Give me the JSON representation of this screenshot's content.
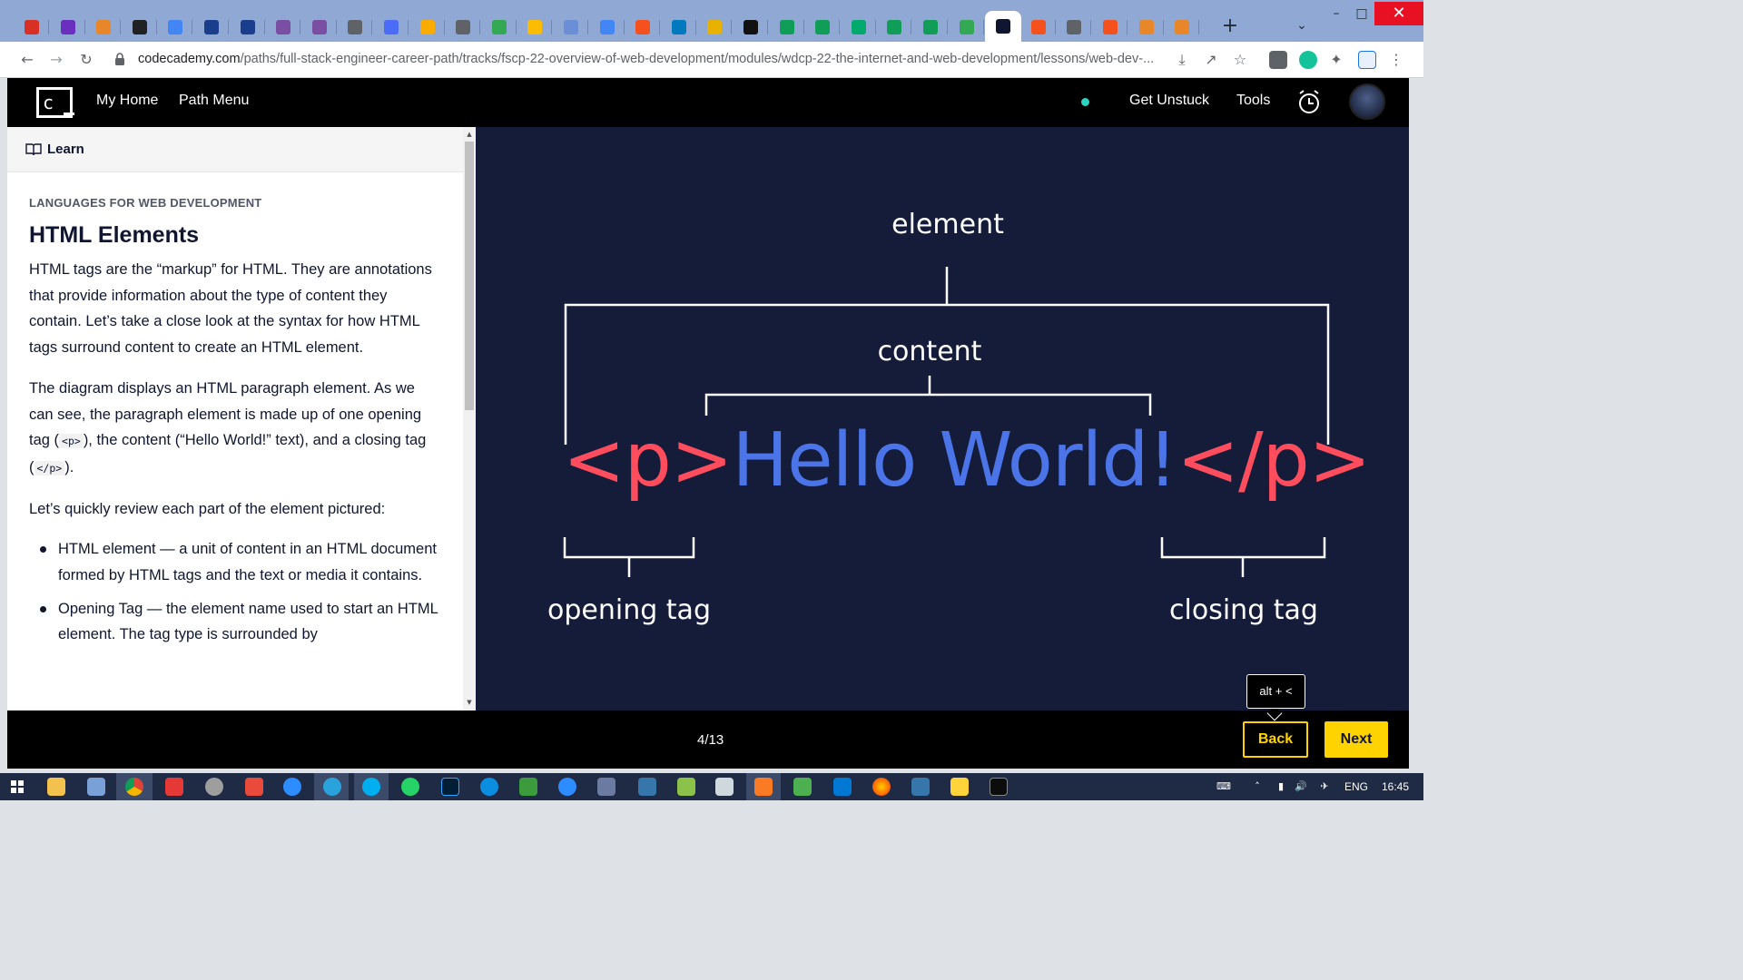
{
  "browser": {
    "tabs": [
      {
        "icon": "gmail-icon",
        "color": "#d93025"
      },
      {
        "icon": "mail-icon",
        "color": "#6b2fbf"
      },
      {
        "icon": "pma-icon",
        "color": "#e8862a"
      },
      {
        "icon": "clock-icon",
        "color": "#202124"
      },
      {
        "icon": "translate-icon",
        "color": "#4285f4"
      },
      {
        "icon": "n-icon",
        "color": "#1a3e8c"
      },
      {
        "icon": "n-icon",
        "color": "#1a3e8c"
      },
      {
        "icon": "triangle-icon",
        "color": "#7a4fa3"
      },
      {
        "icon": "triangle-icon",
        "color": "#7a4fa3"
      },
      {
        "icon": "globe-icon",
        "color": "#5f6368"
      },
      {
        "icon": "people-icon",
        "color": "#4a6cf7"
      },
      {
        "icon": "analytics-icon",
        "color": "#f9ab00"
      },
      {
        "icon": "printer-icon",
        "color": "#5f6368"
      },
      {
        "icon": "ads-icon",
        "color": "#34a853"
      },
      {
        "icon": "ads-icon",
        "color": "#fbbc04"
      },
      {
        "icon": "rpi-icon",
        "color": "#6b8fd6"
      },
      {
        "icon": "doc-icon",
        "color": "#4285f4"
      },
      {
        "icon": "slash-icon",
        "color": "#f4511e"
      },
      {
        "icon": "trello-icon",
        "color": "#0079bf"
      },
      {
        "icon": "chrome-icon",
        "color": "#e8b100"
      },
      {
        "icon": "it-icon",
        "color": "#111111"
      },
      {
        "icon": "plus-icon",
        "color": "#0f9d58"
      },
      {
        "icon": "plus-icon",
        "color": "#0f9d58"
      },
      {
        "icon": "w3-icon",
        "color": "#04aa6d"
      },
      {
        "icon": "gear-green-icon",
        "color": "#0f9d58"
      },
      {
        "icon": "screen-icon",
        "color": "#0f9d58"
      },
      {
        "icon": "table-icon",
        "color": "#34a853"
      },
      {
        "icon": "codecademy-icon",
        "color": "#10162f",
        "active": true
      },
      {
        "icon": "link-icon",
        "color": "#f4511e"
      },
      {
        "icon": "globe-icon",
        "color": "#5f6368"
      },
      {
        "icon": "link-icon",
        "color": "#f4511e"
      },
      {
        "icon": "pma-icon",
        "color": "#e8862a"
      },
      {
        "icon": "pma-icon",
        "color": "#e8862a"
      }
    ],
    "url_domain": "codecademy.com",
    "url_path": "/paths/full-stack-engineer-career-path/tracks/fscp-22-overview-of-web-development/modules/wdcp-22-the-internet-and-web-development/lessons/web-dev-..."
  },
  "header": {
    "logo": "c",
    "my_home": "My Home",
    "path_menu": "Path Menu",
    "get_unstuck": "Get Unstuck",
    "tools": "Tools"
  },
  "learn": {
    "tab_label": "Learn",
    "kicker": "LANGUAGES FOR WEB DEVELOPMENT",
    "title": "HTML Elements",
    "p1": "HTML tags are the “markup” for HTML. They are annotations that provide information about the type of content they contain. Let’s take a close look at the syntax for how HTML tags surround content to create an HTML element.",
    "p2_a": "The diagram displays an HTML paragraph element. As we can see, the paragraph element is made up of one opening tag (",
    "p2_code1": "<p>",
    "p2_b": "), the content (“Hello World!” text), and a closing tag (",
    "p2_code2": "</p>",
    "p2_c": ").",
    "p3": "Let’s quickly review each part of the element pictured:",
    "bullets": [
      "HTML element — a unit of content in an HTML document formed by HTML tags and the text or media it contains.",
      "Opening Tag — the element name used to start an HTML element. The tag type is surrounded by"
    ]
  },
  "diagram": {
    "element_label": "element",
    "content_label": "content",
    "opening_tag": "<p>",
    "content_text": "Hello World!",
    "closing_tag": "</p>",
    "opening_label": "opening tag",
    "closing_label": "closing tag",
    "tag_color": "#ff4d5e",
    "content_color": "#4a74e8",
    "bg_color": "#141c3a"
  },
  "footer": {
    "counter": "4/13",
    "back": "Back",
    "next": "Next",
    "tooltip": "alt + <",
    "accent": "#ffd300"
  },
  "taskbar": {
    "lang": "ENG",
    "time": "16:45"
  }
}
